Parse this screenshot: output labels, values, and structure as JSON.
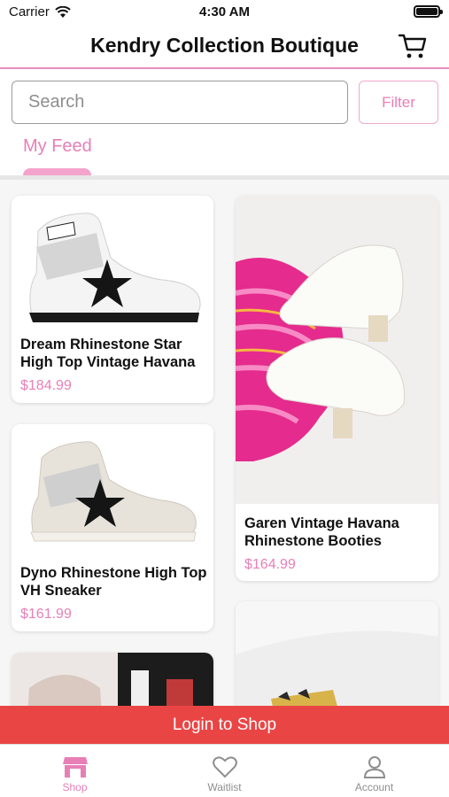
{
  "status": {
    "carrier": "Carrier",
    "time": "4:30 AM"
  },
  "header": {
    "title": "Kendry Collection Boutique"
  },
  "search": {
    "placeholder": "Search",
    "filter_label": "Filter"
  },
  "tabs": [
    {
      "label": "My Feed"
    }
  ],
  "products": [
    {
      "name": "Dream Rhinestone Star High Top Vintage Havana",
      "price": "$184.99"
    },
    {
      "name": "Garen Vintage Havana Rhinestone Booties",
      "price": "$164.99"
    },
    {
      "name": "Dyno Rhinestone High Top VH Sneaker",
      "price": "$161.99"
    }
  ],
  "login_banner": {
    "label": "Login to Shop"
  },
  "tabbar": [
    {
      "label": "Shop",
      "icon": "shop-icon"
    },
    {
      "label": "Waitlist",
      "icon": "heart-icon"
    },
    {
      "label": "Account",
      "icon": "person-icon"
    }
  ],
  "colors": {
    "accent": "#e77fb7",
    "login": "#ea4545",
    "divider": "#e98cbd"
  }
}
